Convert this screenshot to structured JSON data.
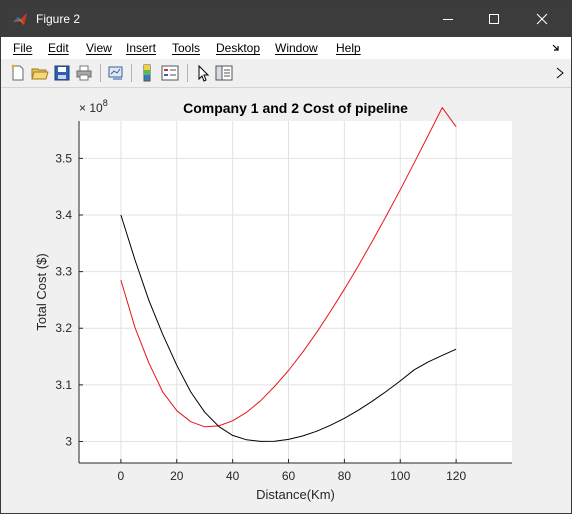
{
  "window": {
    "title": "Figure 2"
  },
  "menu": [
    "File",
    "Edit",
    "View",
    "Insert",
    "Tools",
    "Desktop",
    "Window",
    "Help"
  ],
  "toolbar": {
    "icons": [
      "new-figure-icon",
      "open-file-icon",
      "save-icon",
      "print-icon",
      "link-plot-icon",
      "colorbar-icon",
      "legend-icon",
      "pointer-icon",
      "property-inspector-icon"
    ]
  },
  "chart_data": {
    "type": "line",
    "title": "Company 1 and 2 Cost of pipeline",
    "xlabel": "Distance(Km)",
    "ylabel": "Total Cost ($)",
    "y_exponent_label": "× 10",
    "y_exponent_power": "8",
    "xlim": [
      -15,
      140
    ],
    "ylim": [
      2.962,
      3.566
    ],
    "xticks": [
      0,
      20,
      40,
      60,
      80,
      100,
      120
    ],
    "yticks": [
      3.0,
      3.1,
      3.2,
      3.3,
      3.4,
      3.5
    ],
    "ytick_labels": [
      "3",
      "3.1",
      "3.2",
      "3.3",
      "3.4",
      "3.5"
    ],
    "grid": true,
    "series": [
      {
        "color": "#e8141a",
        "x": [
          0,
          5,
          10,
          15,
          20,
          25,
          30,
          35,
          40,
          45,
          50,
          55,
          60,
          65,
          70,
          75,
          80,
          85,
          90,
          95,
          100,
          105,
          110,
          115,
          120
        ],
        "y": [
          3.285,
          3.2016,
          3.1389,
          3.0872,
          3.0543,
          3.0349,
          3.026,
          3.0276,
          3.0365,
          3.0516,
          3.0721,
          3.0971,
          3.1254,
          3.1574,
          3.1921,
          3.2295,
          3.2689,
          3.3104,
          3.3536,
          3.3984,
          3.4446,
          3.4921,
          3.5405,
          3.5896,
          3.556
        ]
      },
      {
        "color": "#000000",
        "x": [
          0,
          5,
          10,
          15,
          20,
          25,
          30,
          35,
          40,
          45,
          50,
          55,
          60,
          65,
          70,
          75,
          80,
          85,
          90,
          95,
          100,
          105,
          110,
          115,
          120
        ],
        "y": [
          3.4,
          3.3213,
          3.2496,
          3.1888,
          3.1346,
          3.0875,
          3.0517,
          3.0266,
          3.0107,
          3.0029,
          3.0002,
          3.0005,
          3.0037,
          3.0096,
          3.018,
          3.0285,
          3.041,
          3.0552,
          3.0712,
          3.0885,
          3.107,
          3.1266,
          3.1405,
          3.152,
          3.163
        ]
      }
    ]
  }
}
